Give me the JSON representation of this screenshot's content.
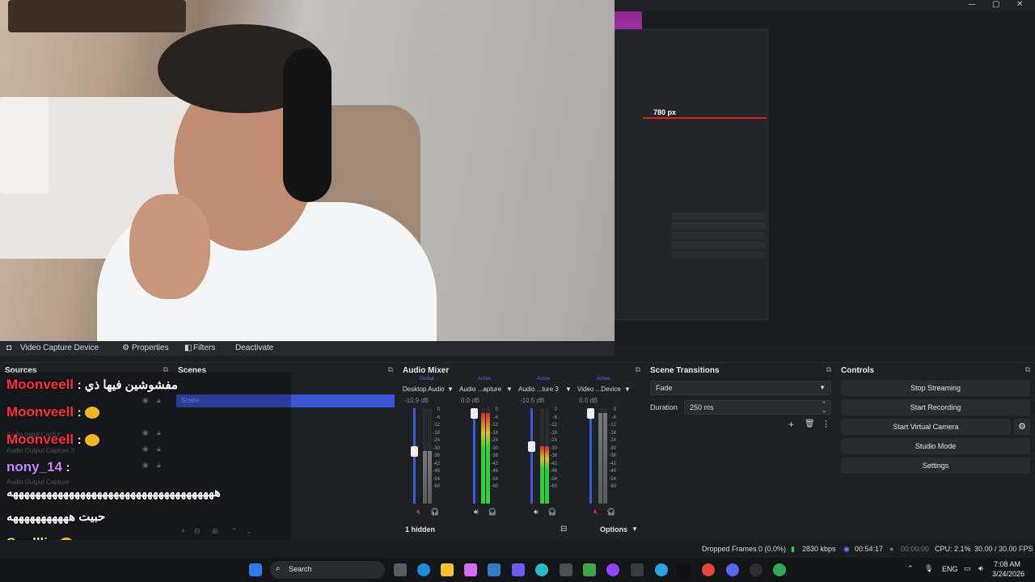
{
  "window": {
    "minimize": "—",
    "maximize": "▢",
    "close": "✕"
  },
  "preview": {
    "px_label": "780 px"
  },
  "propbar": {
    "source_name": "Video Capture Device",
    "properties": "Properties",
    "filters": "Filters",
    "deactivate": "Deactivate"
  },
  "docks": {
    "sources": "Sources",
    "scenes": "Scenes",
    "mixer": "Audio Mixer",
    "transitions": "Scene Transitions",
    "controls": "Controls"
  },
  "sources": {
    "items": [
      "Audio Input Captur",
      "Audio Output Capture 3",
      "Audio Output Capture"
    ],
    "scene": "Scene"
  },
  "chat": [
    {
      "nick": "Moonveell",
      "text": ": مفشوشين فيها ذي",
      "style": "red",
      "emoji": false
    },
    {
      "nick": "Moonveell",
      "text": ":",
      "style": "red",
      "emoji": true
    },
    {
      "nick": "Moonveell",
      "text": ":",
      "style": "red",
      "emoji": true
    },
    {
      "nick": "nony_14",
      "text": ":",
      "style": "purple",
      "emoji": false
    },
    {
      "nick": "",
      "text": "هههههههههههههههههههههههههههههههههههههه",
      "style": "text",
      "emoji": false
    },
    {
      "nick": "",
      "text": "حبيت هههههههههههه",
      "style": "text",
      "emoji": false
    },
    {
      "nick": "Suullli",
      "text": ":",
      "style": "green",
      "emoji": true
    }
  ],
  "mixer": {
    "channels": [
      {
        "tag": "Global",
        "name": "Desktop Audio",
        "db": "-10.9 dB",
        "level": 0.55,
        "muted": true
      },
      {
        "tag": "Active",
        "name": "Audio ...apture",
        "db": "0.0 dB",
        "level": 0.95,
        "muted": false
      },
      {
        "tag": "Active",
        "name": "Audio ...ture 3",
        "db": "-10.5 dB",
        "level": 0.6,
        "muted": false
      },
      {
        "tag": "Active",
        "name": "Video ...Device",
        "db": "0.0 dB",
        "level": 0.95,
        "muted": true
      }
    ],
    "scale": [
      "0",
      "-6",
      "-12",
      "-18",
      "-24",
      "-30",
      "-36",
      "-42",
      "-48",
      "-54",
      "-60"
    ],
    "hidden": "1 hidden",
    "options": "Options"
  },
  "transitions": {
    "type": "Fade",
    "duration_label": "Duration",
    "duration": "250 ms"
  },
  "controls": {
    "stop_streaming": "Stop Streaming",
    "start_recording": "Start Recording",
    "start_virtual_camera": "Start Virtual Camera",
    "studio_mode": "Studio Mode",
    "settings": "Settings"
  },
  "status": {
    "dropped": "Dropped Frames 0 (0.0%)",
    "kbps": "2830 kbps",
    "stream_time": "00:54:17",
    "rec_time": "00:00:00",
    "cpu": "CPU: 2.1%",
    "fps": "30.00 / 30.00 FPS"
  },
  "taskbar": {
    "search": "Search",
    "lang": "ENG",
    "time": "7:08 AM",
    "date": "3/24/2026"
  },
  "colors": {
    "accent": "#3b55d4",
    "live_red": "#e01c1c",
    "meter_green": "#2fd13a"
  }
}
